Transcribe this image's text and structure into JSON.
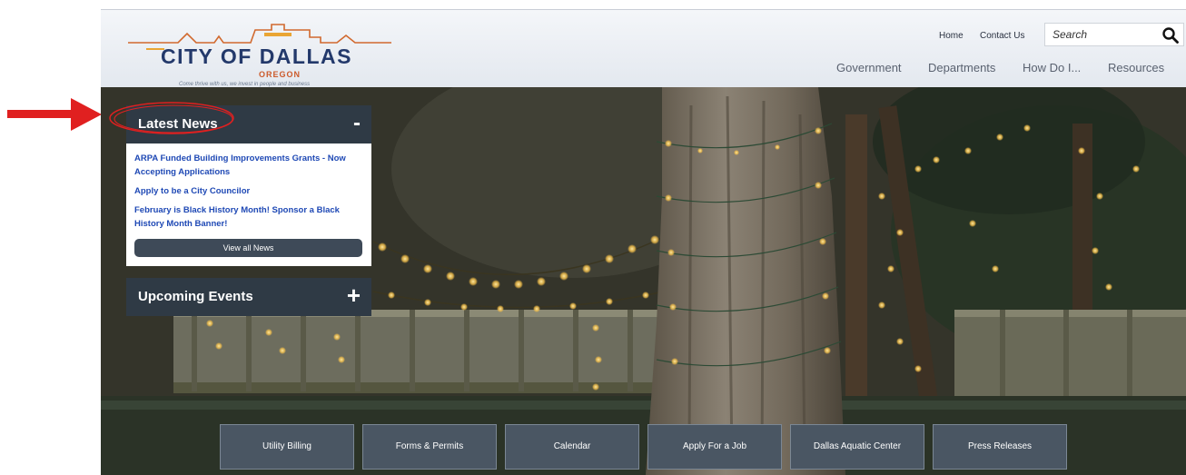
{
  "logo": {
    "name": "CITY OF DALLAS",
    "state": "OREGON",
    "tagline": "Come thrive with us, we invest in people and business"
  },
  "utility_nav": {
    "home": "Home",
    "contact": "Contact Us"
  },
  "search": {
    "placeholder": "Search"
  },
  "main_nav": [
    "Government",
    "Departments",
    "How Do I...",
    "Resources"
  ],
  "latest_news": {
    "title": "Latest News",
    "toggle": "-",
    "items": [
      "ARPA Funded Building Improvements Grants - Now Accepting Applications",
      "Apply to be a City Councilor",
      "February is Black History Month! Sponsor a Black History Month Banner!"
    ],
    "view_all": "View all News"
  },
  "upcoming_events": {
    "title": "Upcoming Events",
    "toggle": "+"
  },
  "quick_links": [
    "Utility Billing",
    "Forms & Permits",
    "Calendar",
    "Apply For a Job",
    "Dallas Aquatic Center",
    "Press Releases"
  ],
  "colors": {
    "panel": "#2f3a45",
    "link": "#1f49b5",
    "annotation": "#e02020",
    "brand": "#23396b"
  },
  "icons": [
    "arrow-annotation",
    "search-icon",
    "minus-icon",
    "plus-icon"
  ]
}
